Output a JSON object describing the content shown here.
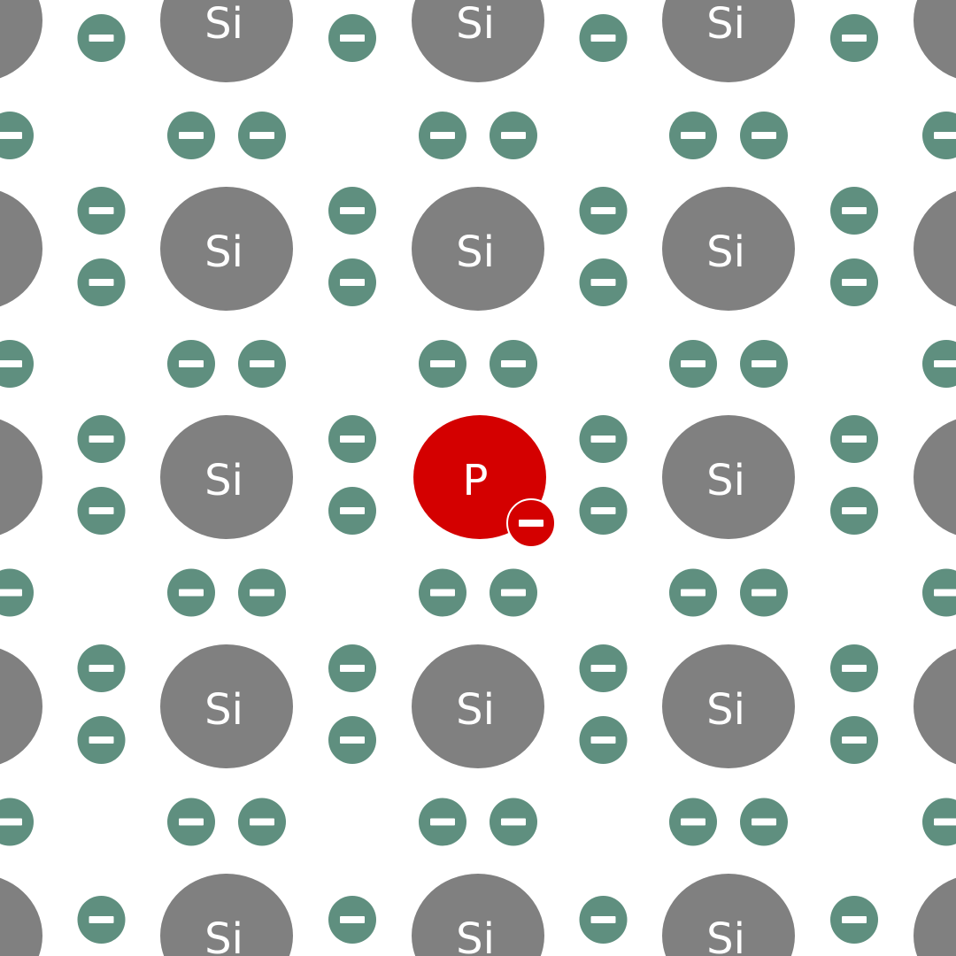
{
  "diagram": {
    "kind": "semiconductor crystal lattice with dopant",
    "host_atom": {
      "symbol": "Si",
      "color": "#808080",
      "label_color": "#ffffff"
    },
    "dopant_atom": {
      "symbol": "P",
      "color": "#d40000",
      "label_color": "#ffffff",
      "lattice_position": {
        "row": 2,
        "col": 2
      }
    },
    "electron": {
      "symbol": "minus",
      "color": "#5f8f7f",
      "sign_color": "#ffffff"
    },
    "free_electron": {
      "color": "#d40000",
      "outline_color": "#ffffff",
      "attached_to": "dopant_atom"
    },
    "lattice": {
      "rows": 5,
      "cols": 5,
      "bond_electrons_per_link": 2
    }
  }
}
